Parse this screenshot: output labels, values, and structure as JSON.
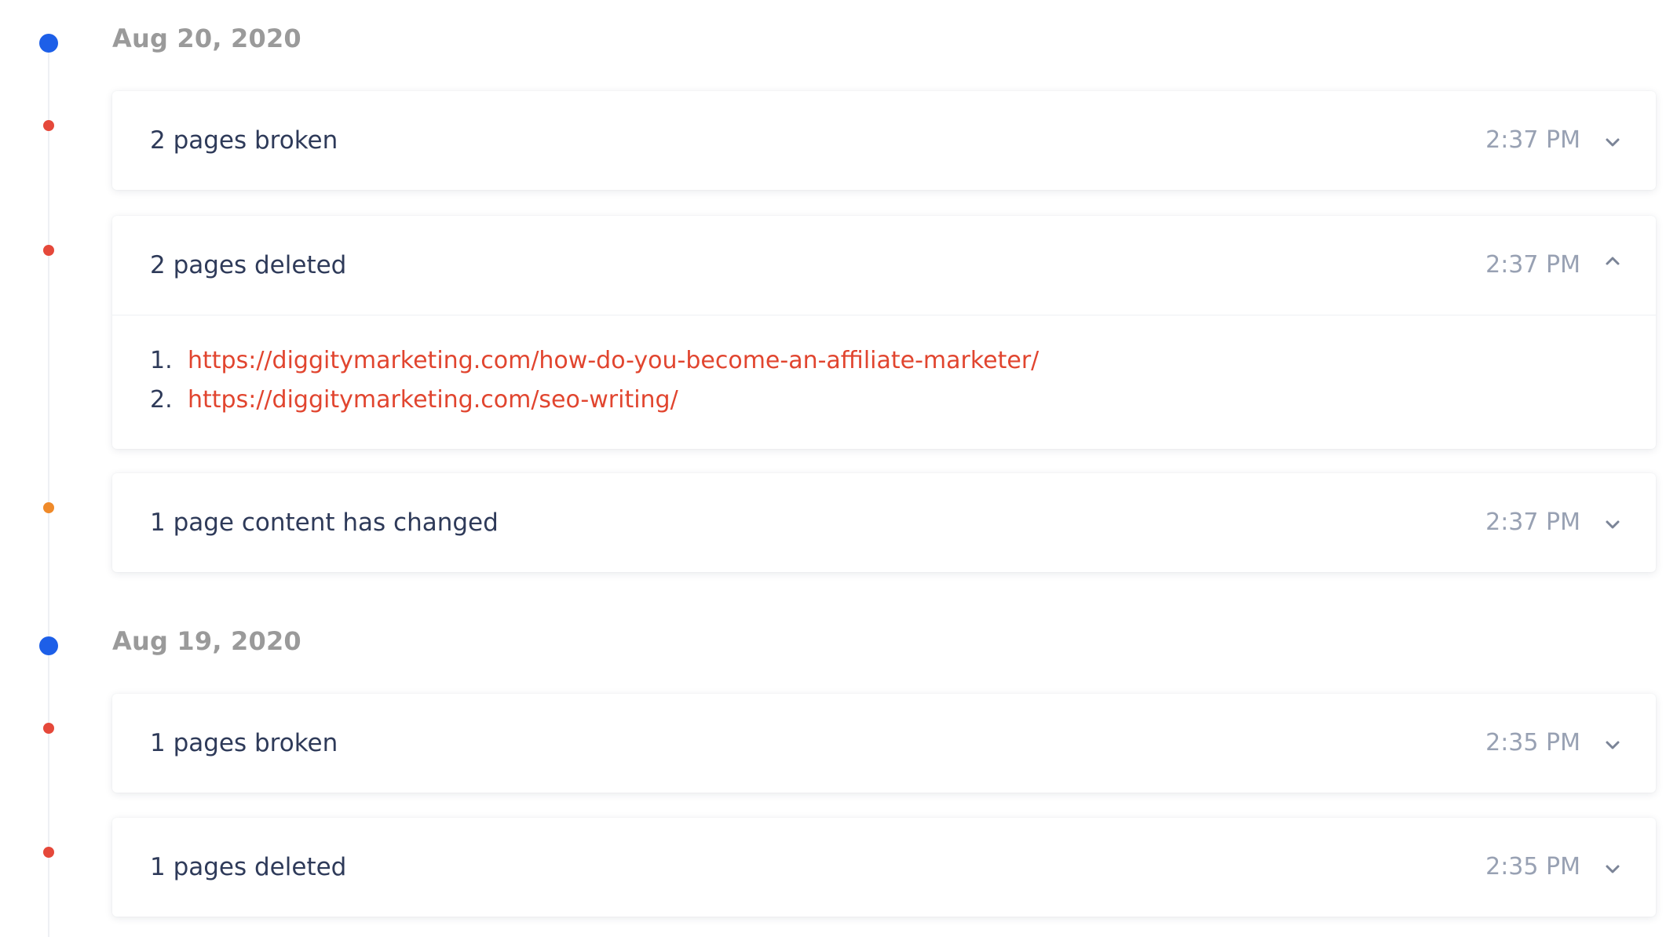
{
  "colors": {
    "date_dot": "#1d5fe8",
    "broken": "#e5483a",
    "deleted": "#e5483a",
    "changed": "#ef8a2a",
    "link": "#e1452f"
  },
  "groups": [
    {
      "date": "Aug 20, 2020",
      "events": [
        {
          "title": "2 pages broken",
          "time": "2:37 PM",
          "status": "broken",
          "toggle_icon": "chevron-down-icon"
        },
        {
          "title": "2 pages deleted",
          "time": "2:37 PM",
          "status": "deleted",
          "toggle_icon": "chevron-up-icon",
          "expanded": true,
          "items": [
            {
              "num": "1.",
              "url": "https://diggitymarketing.com/how-do-you-become-an-affiliate-marketer/"
            },
            {
              "num": "2.",
              "url": "https://diggitymarketing.com/seo-writing/"
            }
          ]
        },
        {
          "title": "1 page content has changed",
          "time": "2:37 PM",
          "status": "changed",
          "toggle_icon": "chevron-down-icon"
        }
      ]
    },
    {
      "date": "Aug 19, 2020",
      "events": [
        {
          "title": "1 pages broken",
          "time": "2:35 PM",
          "status": "broken",
          "toggle_icon": "chevron-down-icon"
        },
        {
          "title": "1 pages deleted",
          "time": "2:35 PM",
          "status": "deleted",
          "toggle_icon": "chevron-down-icon"
        }
      ]
    }
  ]
}
